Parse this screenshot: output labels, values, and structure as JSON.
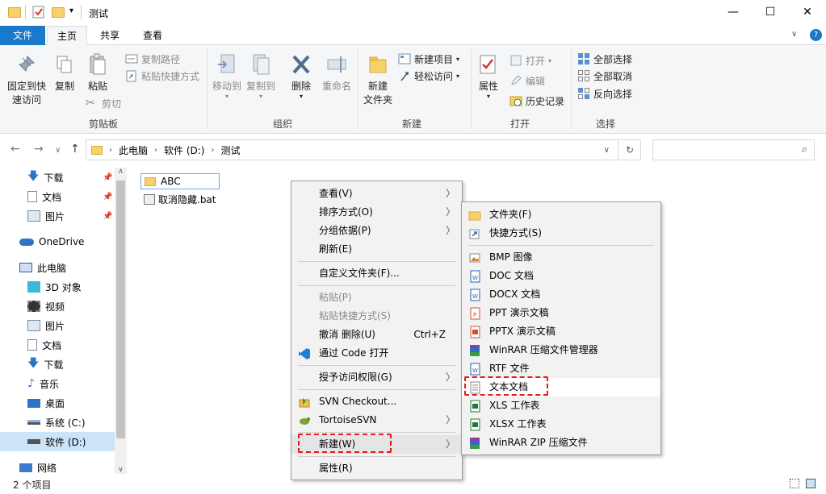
{
  "window": {
    "title": "测试",
    "controls": {
      "minimize": "—",
      "maximize": "☐",
      "close": "✕"
    }
  },
  "ribbon_tabs": [
    "文件",
    "主页",
    "共享",
    "查看"
  ],
  "ribbon": {
    "clipboard": {
      "label": "剪贴板",
      "pin": "固定到快\n速访问",
      "copy": "复制",
      "paste": "粘贴",
      "copy_path": "复制路径",
      "paste_shortcut": "粘贴快捷方式",
      "cut": "剪切"
    },
    "organize": {
      "label": "组织",
      "move_to": "移动到",
      "copy_to": "复制到",
      "delete": "删除",
      "rename": "重命名"
    },
    "new": {
      "label": "新建",
      "new_folder": "新建\n文件夹",
      "new_item": "新建项目",
      "easy_access": "轻松访问"
    },
    "open": {
      "label": "打开",
      "properties": "属性",
      "open": "打开",
      "edit": "编辑",
      "history": "历史记录"
    },
    "select": {
      "label": "选择",
      "select_all": "全部选择",
      "select_none": "全部取消",
      "invert": "反向选择"
    }
  },
  "address": {
    "crumbs": [
      "此电脑",
      "软件 (D:)",
      "测试"
    ],
    "search_placeholder": ""
  },
  "sidebar": {
    "items": [
      {
        "label": "下载",
        "icon": "download-icon",
        "pinned": true
      },
      {
        "label": "文档",
        "icon": "document-icon",
        "pinned": true
      },
      {
        "label": "图片",
        "icon": "picture-icon",
        "pinned": true
      },
      {
        "label": "OneDrive",
        "icon": "cloud-icon"
      },
      {
        "label": "此电脑",
        "icon": "computer-icon"
      },
      {
        "label": "3D 对象",
        "icon": "cube-icon"
      },
      {
        "label": "视频",
        "icon": "video-icon"
      },
      {
        "label": "图片",
        "icon": "picture-icon"
      },
      {
        "label": "文档",
        "icon": "document-icon"
      },
      {
        "label": "下载",
        "icon": "download-icon"
      },
      {
        "label": "音乐",
        "icon": "music-icon"
      },
      {
        "label": "桌面",
        "icon": "desktop-icon"
      },
      {
        "label": "系统 (C:)",
        "icon": "drive-icon"
      },
      {
        "label": "软件 (D:)",
        "icon": "drive-icon",
        "selected": true
      },
      {
        "label": "网络",
        "icon": "network-icon"
      }
    ]
  },
  "files": [
    {
      "name": "ABC",
      "icon": "folder-icon",
      "editing": true
    },
    {
      "name": "取消隐藏.bat",
      "icon": "bat-file-icon"
    }
  ],
  "status": {
    "count": "2 个项目"
  },
  "context_menu": {
    "items": [
      {
        "label": "查看(V)",
        "submenu": true
      },
      {
        "label": "排序方式(O)",
        "submenu": true
      },
      {
        "label": "分组依据(P)",
        "submenu": true
      },
      {
        "label": "刷新(E)"
      },
      {
        "label": "自定义文件夹(F)..."
      },
      {
        "label": "粘贴(P)",
        "disabled": true
      },
      {
        "label": "粘贴快捷方式(S)",
        "disabled": true
      },
      {
        "label": "撤消 删除(U)",
        "shortcut": "Ctrl+Z"
      },
      {
        "label": "通过 Code 打开",
        "icon": "vscode-icon"
      },
      {
        "label": "授予访问权限(G)",
        "submenu": true
      },
      {
        "label": "SVN Checkout...",
        "icon": "svn-checkout-icon"
      },
      {
        "label": "TortoiseSVN",
        "icon": "tortoisesvn-icon",
        "submenu": true
      },
      {
        "label": "新建(W)",
        "submenu": true,
        "highlighted": true
      },
      {
        "label": "属性(R)"
      }
    ]
  },
  "new_submenu": {
    "items": [
      {
        "label": "文件夹(F)",
        "icon": "folder-icon"
      },
      {
        "label": "快捷方式(S)",
        "icon": "shortcut-icon"
      },
      {
        "label": "BMP 图像",
        "icon": "bmp-icon"
      },
      {
        "label": "DOC 文档",
        "icon": "doc-icon"
      },
      {
        "label": "DOCX 文档",
        "icon": "docx-icon"
      },
      {
        "label": "PPT 演示文稿",
        "icon": "ppt-icon"
      },
      {
        "label": "PPTX 演示文稿",
        "icon": "pptx-icon"
      },
      {
        "label": "WinRAR 压缩文件管理器",
        "icon": "winrar-icon"
      },
      {
        "label": "RTF 文件",
        "icon": "rtf-icon"
      },
      {
        "label": "文本文档",
        "icon": "text-document-icon",
        "highlighted": true
      },
      {
        "label": "XLS 工作表",
        "icon": "xls-icon"
      },
      {
        "label": "XLSX 工作表",
        "icon": "xlsx-icon"
      },
      {
        "label": "WinRAR ZIP 压缩文件",
        "icon": "winrar-zip-icon"
      }
    ]
  },
  "colors": {
    "accent": "#1979ca",
    "highlight_dash": "#e21b1b"
  }
}
